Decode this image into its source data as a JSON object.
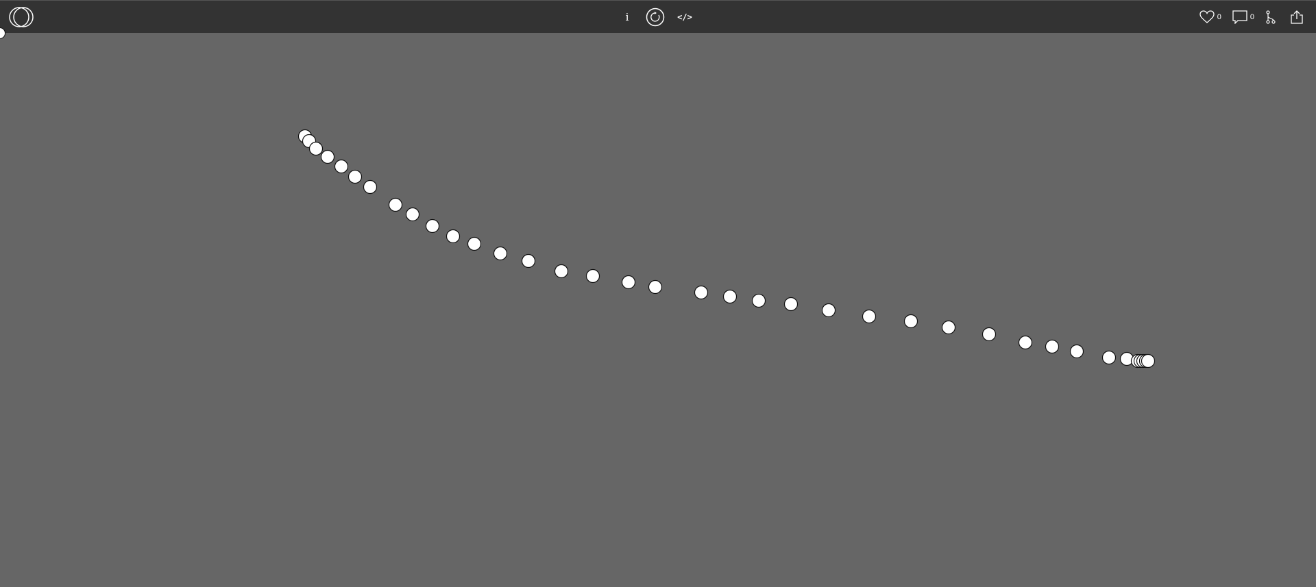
{
  "toolbar": {
    "logo_icon": "openprocessing-logo-icon",
    "info_label": "i",
    "restart_icon": "restart-icon",
    "code_label": "</>",
    "likes_count": "0",
    "comments_count": "0",
    "fork_icon": "fork-icon",
    "share_icon": "share-icon"
  },
  "sketch": {
    "background_color": "#666666",
    "dot_fill": "#ffffff",
    "dot_stroke": "#111111",
    "dot_count": 43
  }
}
